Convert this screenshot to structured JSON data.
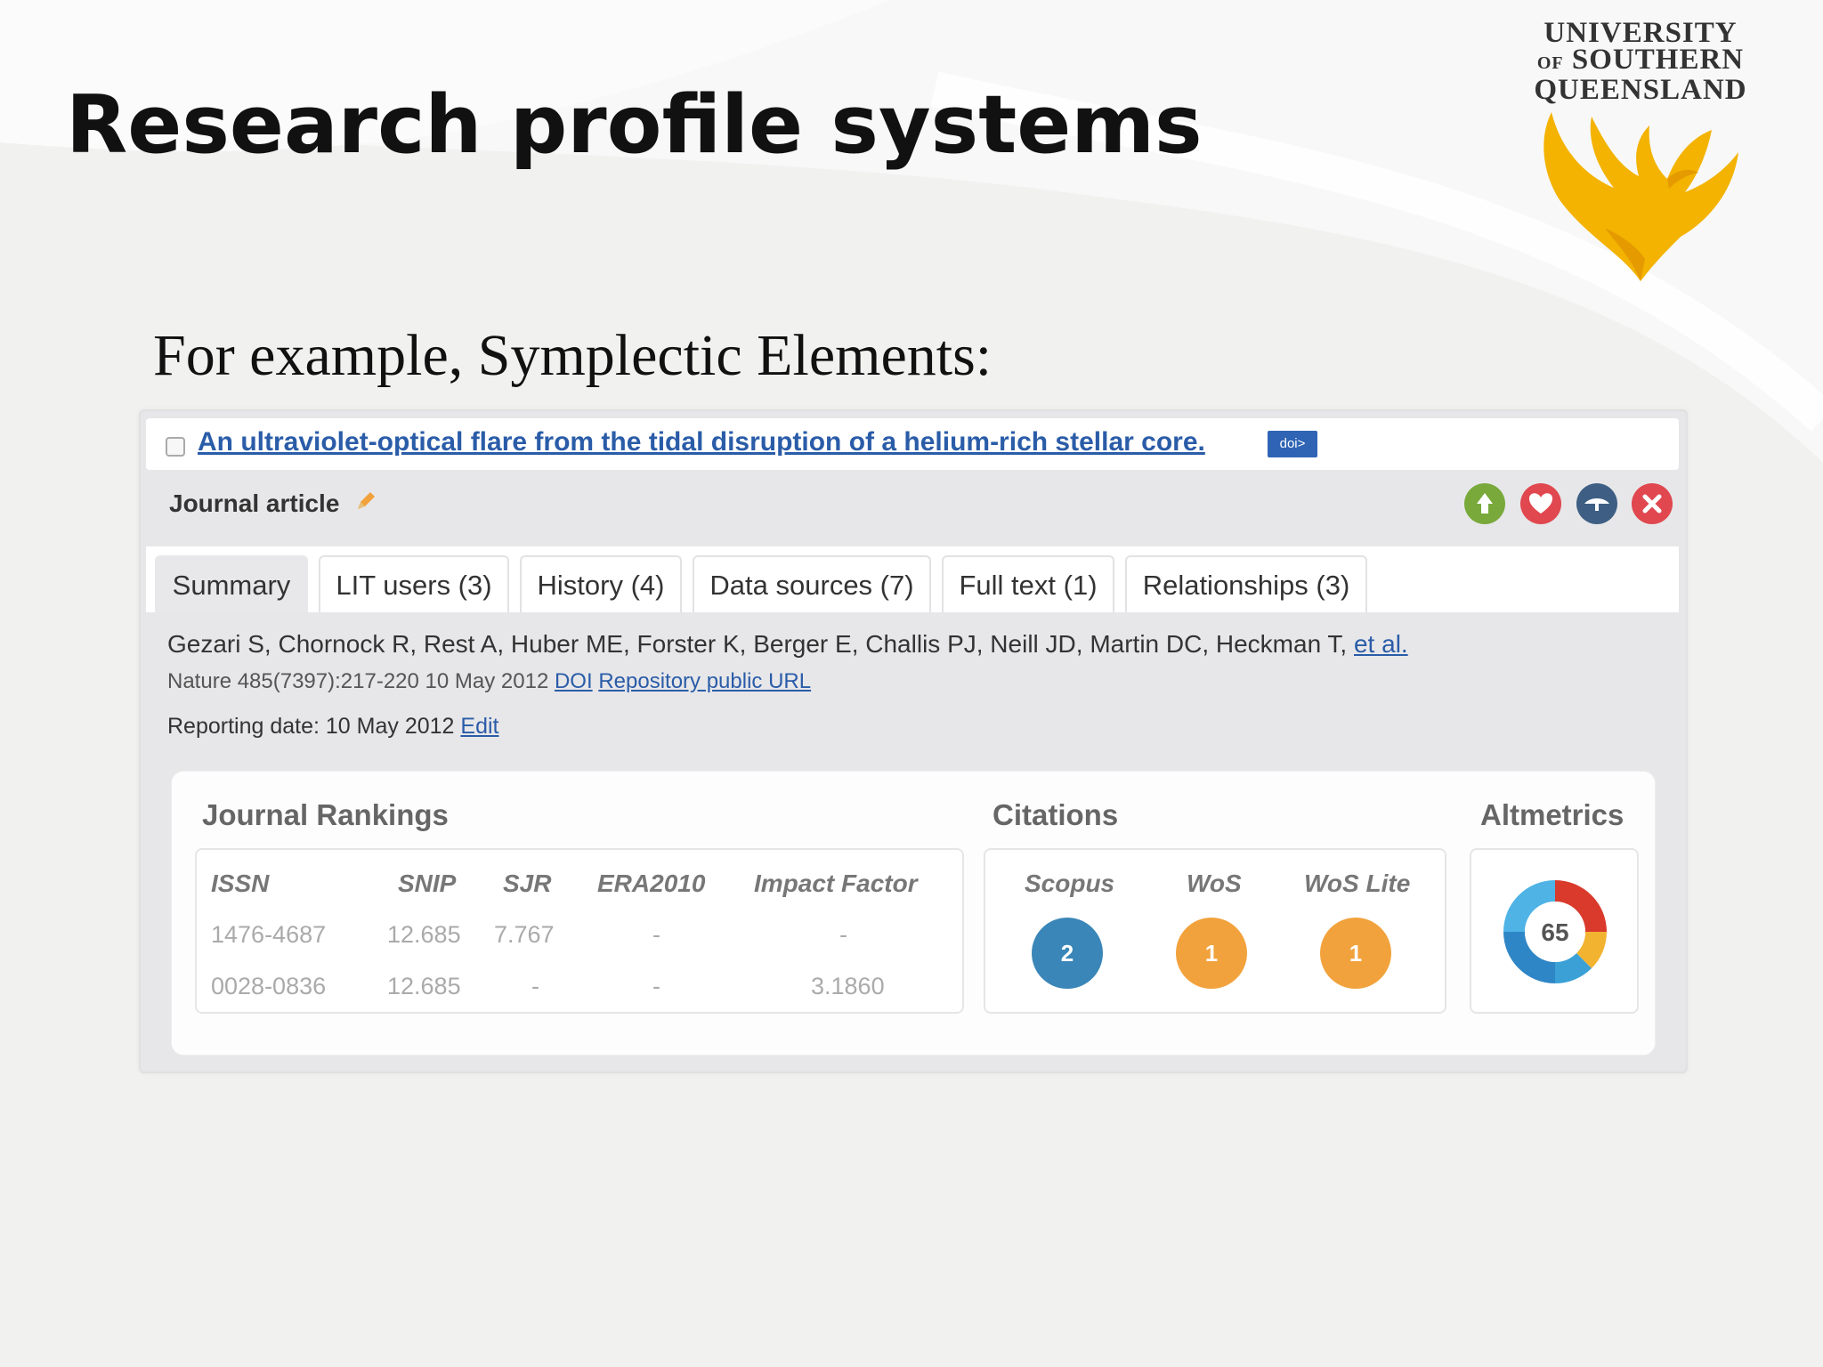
{
  "slide": {
    "title": "Research profile systems",
    "subtitle": "For example, Symplectic Elements:"
  },
  "logo": {
    "line1": "UNIVERSITY",
    "line2_of": "OF",
    "line2": "SOUTHERN",
    "line3": "QUEENSLAND",
    "color": "#f3b300"
  },
  "publication": {
    "title": "An ultraviolet-optical flare from the tidal disruption of a helium-rich stellar core.",
    "doi_badge": "doi>",
    "type": "Journal article",
    "actions": [
      {
        "icon": "add-icon",
        "color": "#78a93a"
      },
      {
        "icon": "heart-icon",
        "color": "#e0474f"
      },
      {
        "icon": "visibility-icon",
        "color": "#3e5f83"
      },
      {
        "icon": "delete-icon",
        "color": "#e0474f"
      }
    ],
    "tabs": [
      "Summary",
      "LIT users (3)",
      "History (4)",
      "Data sources (7)",
      "Full text (1)",
      "Relationships (3)"
    ],
    "authors": "Gezari S, Chornock R, Rest A, Huber ME, Forster K, Berger E, Challis PJ, Neill JD, Martin DC, Heckman T,",
    "authors_more": "et al.",
    "citation": "Nature 485(7397):217-220 10 May 2012",
    "doi_link": "DOI",
    "repo_link": "Repository public URL",
    "reporting_label": "Reporting date: 10 May 2012",
    "edit_link": "Edit"
  },
  "metrics": {
    "rankings": {
      "heading": "Journal Rankings",
      "columns": [
        "ISSN",
        "SNIP",
        "SJR",
        "ERA2010",
        "Impact Factor"
      ],
      "rows": [
        [
          "1476-4687",
          "12.685",
          "7.767",
          "-",
          "-"
        ],
        [
          "0028-0836",
          "12.685",
          "-",
          "-",
          "3.1860"
        ]
      ]
    },
    "citations": {
      "heading": "Citations",
      "sources": [
        {
          "label": "Scopus",
          "count": "2",
          "color": "#3a86b8"
        },
        {
          "label": "WoS",
          "count": "1",
          "color": "#f2a23c"
        },
        {
          "label": "WoS Lite",
          "count": "1",
          "color": "#f2a23c"
        }
      ]
    },
    "altmetrics": {
      "heading": "Altmetrics",
      "score": "65"
    }
  }
}
